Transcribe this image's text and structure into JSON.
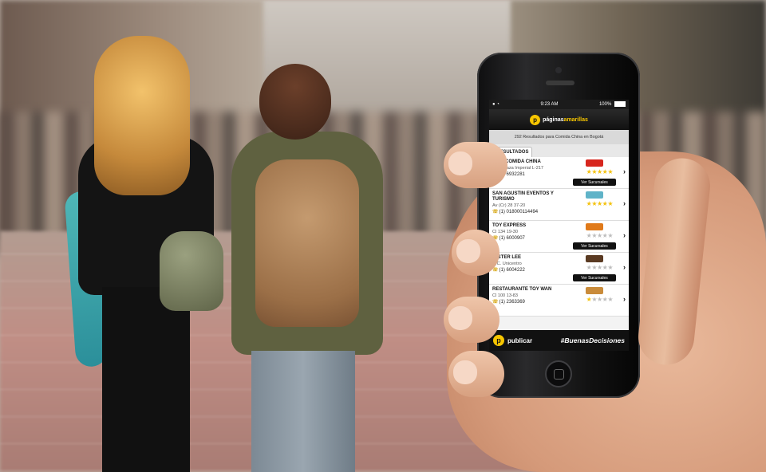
{
  "status_bar": {
    "time": "9:23 AM",
    "battery": "100%"
  },
  "app": {
    "logo_letter": "p",
    "brand_prefix": "páginas",
    "brand_suffix": "amarillas",
    "results_summary": "292 Resultados para Comida China en Bogotá"
  },
  "tabs": [
    {
      "label": "RESULTADOS",
      "selected": true
    }
  ],
  "results": [
    {
      "name": "XIAN COMIDA CHINA",
      "address": "C.C. Plaza Imperial L-217",
      "phone": "(1) 6932281",
      "rating": 5,
      "logo_color": "#d7261e",
      "has_branches": true,
      "branches_label": "Ver Sucursales"
    },
    {
      "name": "SAN AGUSTIN EVENTOS Y TURISMO",
      "address": "Av (Cr) 28 37-20",
      "phone": "(1) 018000114494",
      "rating": 5,
      "logo_color": "#5fb3c8",
      "has_branches": false
    },
    {
      "name": "TOY EXPRESS",
      "address": "Cl 134 19-30",
      "phone": "(1) 6000907",
      "rating": 0,
      "logo_color": "#e07a1a",
      "has_branches": true,
      "branches_label": "Ver Sucursales"
    },
    {
      "name": "MISTER LEE",
      "address": "C.C. Unicentro",
      "phone": "(1) 6004222",
      "rating": 0,
      "logo_color": "#5a3a22",
      "has_branches": true,
      "branches_label": "Ver Sucursales"
    },
    {
      "name": "RESTAURANTE TOY WAN",
      "address": "Cl 100 13-83",
      "phone": "(1) 2363369",
      "rating": 1,
      "logo_color": "#c98b3a",
      "has_branches": false
    }
  ],
  "phone_prefix_glyph": "☏",
  "chevron": "›",
  "star_glyph": "★",
  "banner": {
    "logo_letter": "p",
    "brand": "publicar",
    "hashtag": "#BuenasDecisiones"
  },
  "colors": {
    "accent_yellow": "#f7c600",
    "star_on": "#f4c20d",
    "star_off": "#bdbdbd"
  }
}
